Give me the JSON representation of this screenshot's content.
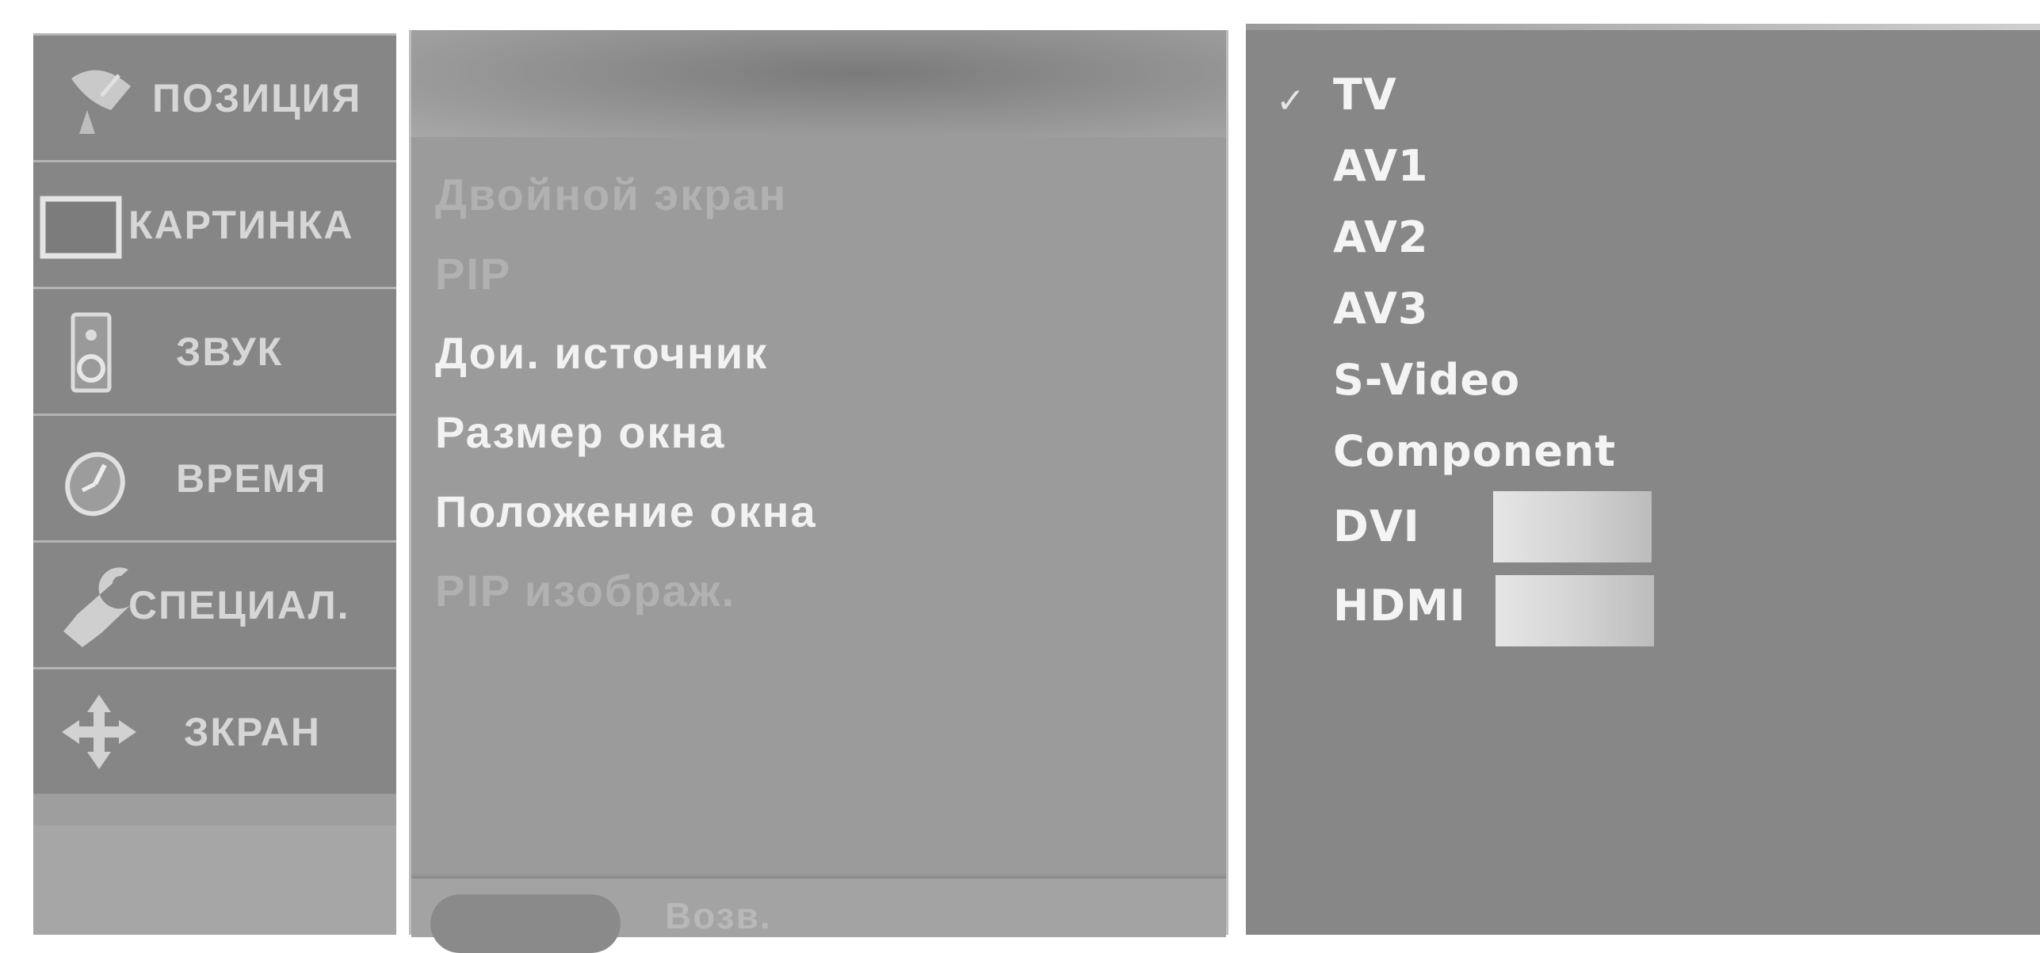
{
  "categories": [
    {
      "label": "ПОЗИЦИЯ",
      "icon": "satellite-dish-icon"
    },
    {
      "label": "КАРТИНКА",
      "icon": "tv-screen-icon"
    },
    {
      "label": "ЗВУК",
      "icon": "speaker-icon"
    },
    {
      "label": "ВРЕМЯ",
      "icon": "clock-icon"
    },
    {
      "label": "СПЕЦИАЛ.",
      "icon": "wrench-icon"
    },
    {
      "label": "ЗКРАН",
      "icon": "move-arrows-icon"
    }
  ],
  "submenu": {
    "items": [
      {
        "label": "Двойной экран"
      },
      {
        "label": "PIP"
      },
      {
        "label": "Дои. источник"
      },
      {
        "label": "Размер окна"
      },
      {
        "label": "Положение окна"
      },
      {
        "label": "PIP изображ."
      }
    ],
    "back_label": "Возв."
  },
  "sources": {
    "items": [
      {
        "label": "TV",
        "checked": true
      },
      {
        "label": "AV1"
      },
      {
        "label": "AV2"
      },
      {
        "label": "AV3"
      },
      {
        "label": "S-Video"
      },
      {
        "label": "Component"
      },
      {
        "label": "DVI"
      },
      {
        "label": "HDMI"
      }
    ],
    "check_glyph": "✓"
  },
  "colors": {
    "panel": "#878787",
    "sidebar_item": "#868686",
    "active_text": "#f2f2f2",
    "dim_text": "#b1b1b1"
  }
}
